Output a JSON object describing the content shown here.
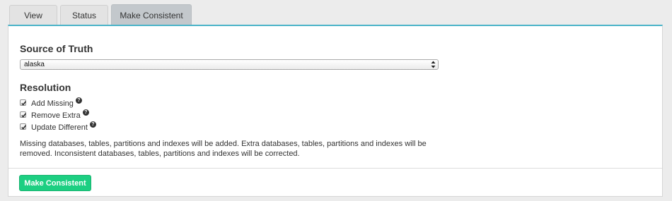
{
  "tabs": [
    {
      "label": "View",
      "active": false
    },
    {
      "label": "Status",
      "active": false
    },
    {
      "label": "Make Consistent",
      "active": true
    }
  ],
  "source_of_truth": {
    "title": "Source of Truth",
    "selected": "alaska"
  },
  "resolution": {
    "title": "Resolution",
    "options": [
      {
        "label": "Add Missing",
        "checked": true,
        "help": "?"
      },
      {
        "label": "Remove Extra",
        "checked": true,
        "help": "?"
      },
      {
        "label": "Update Different",
        "checked": true,
        "help": "?"
      }
    ],
    "description": "Missing databases, tables, partitions and indexes will be added. Extra databases, tables, partitions and indexes will be removed. Inconsistent databases, tables, partitions and indexes will be corrected."
  },
  "actions": {
    "make_consistent_label": "Make Consistent"
  },
  "colors": {
    "accent": "#4ab3c8",
    "button": "#1dcf82"
  }
}
